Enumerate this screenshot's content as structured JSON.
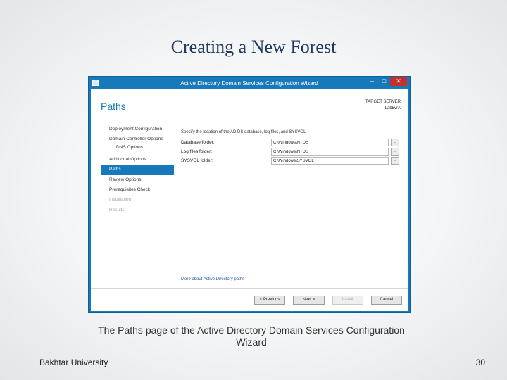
{
  "slide": {
    "title": "Creating a New Forest",
    "caption": "The Paths page of the Active Directory Domain Services Configuration Wizard",
    "footer_left": "Bakhtar University",
    "page_number": "30"
  },
  "window": {
    "title": "Active Directory Domain Services Configuration Wizard",
    "minimize_glyph": "–",
    "maximize_glyph": "□",
    "close_glyph": "✕",
    "page_heading": "Paths",
    "target_server_label": "TARGET SERVER",
    "target_server_name": "Lab5vrA"
  },
  "nav": {
    "items": [
      {
        "label": "Deployment Configuration"
      },
      {
        "label": "Domain Controller Options"
      },
      {
        "label": "DNS Options"
      },
      {
        "label": "Additional Options"
      },
      {
        "label": "Paths"
      },
      {
        "label": "Review Options"
      },
      {
        "label": "Prerequisites Check"
      },
      {
        "label": "Installation"
      },
      {
        "label": "Results"
      }
    ]
  },
  "content": {
    "intro": "Specify the location of the AD DS database, log files, and SYSVOL",
    "browse_label": "...",
    "rows": [
      {
        "label": "Database folder:",
        "value": "C:\\Windows\\NTDS"
      },
      {
        "label": "Log files folder:",
        "value": "C:\\Windows\\NTDS"
      },
      {
        "label": "SYSVOL folder:",
        "value": "C:\\Windows\\SYSVOL"
      }
    ],
    "more_link": "More about Active Directory paths"
  },
  "buttons": {
    "previous": "< Previous",
    "next": "Next >",
    "install": "Install",
    "cancel": "Cancel"
  },
  "colors": {
    "accent": "#1779ba",
    "close": "#c7302a"
  }
}
